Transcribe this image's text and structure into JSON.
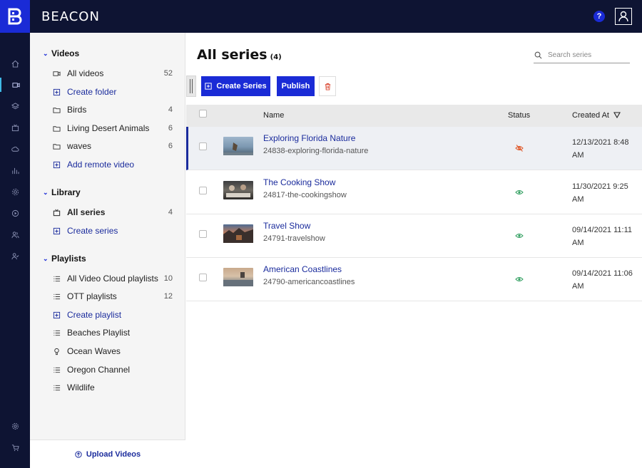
{
  "app": {
    "brand": "BEACON",
    "help_label": "?"
  },
  "sidebar": {
    "videos_heading": "Videos",
    "videos": [
      {
        "label": "All videos",
        "count": "52",
        "icon": "video-icon"
      },
      {
        "label": "Create folder",
        "count": "",
        "icon": "plus-square-icon"
      },
      {
        "label": "Birds",
        "count": "4",
        "icon": "folder-icon"
      },
      {
        "label": "Living Desert Animals",
        "count": "6",
        "icon": "folder-icon"
      },
      {
        "label": "waves",
        "count": "6",
        "icon": "folder-icon"
      },
      {
        "label": "Add remote video",
        "count": "",
        "icon": "plus-square-icon"
      }
    ],
    "library_heading": "Library",
    "library": [
      {
        "label": "All series",
        "count": "4",
        "icon": "tv-icon"
      },
      {
        "label": "Create series",
        "count": "",
        "icon": "plus-square-icon"
      }
    ],
    "playlists_heading": "Playlists",
    "playlists": [
      {
        "label": "All Video Cloud playlists",
        "count": "10",
        "icon": "list-icon"
      },
      {
        "label": "OTT playlists",
        "count": "12",
        "icon": "list-icon"
      },
      {
        "label": "Create playlist",
        "count": "",
        "icon": "plus-square-icon"
      },
      {
        "label": "Beaches Playlist",
        "count": "",
        "icon": "list-icon"
      },
      {
        "label": "Ocean Waves",
        "count": "",
        "icon": "lightbulb-icon"
      },
      {
        "label": "Oregon Channel",
        "count": "",
        "icon": "list-icon"
      },
      {
        "label": "Wildlife",
        "count": "",
        "icon": "list-icon"
      }
    ],
    "upload_label": "Upload Videos"
  },
  "main": {
    "title": "All series",
    "title_count": "(4)",
    "search_placeholder": "Search series",
    "create_label": "Create Series",
    "publish_label": "Publish",
    "columns": {
      "name": "Name",
      "status": "Status",
      "created": "Created At"
    },
    "rows": [
      {
        "name": "Exploring Florida Nature",
        "slug": "24838-exploring-florida-nature",
        "status": "hidden",
        "created_line1": "12/13/2021 8:48",
        "created_line2": "AM"
      },
      {
        "name": "The Cooking Show",
        "slug": "24817-the-cookingshow",
        "status": "visible",
        "created_line1": "11/30/2021 9:25",
        "created_line2": "AM"
      },
      {
        "name": "Travel Show",
        "slug": "24791-travelshow",
        "status": "visible",
        "created_line1": "09/14/2021 11:11",
        "created_line2": "AM"
      },
      {
        "name": "American Coastlines",
        "slug": "24790-americancoastlines",
        "status": "visible",
        "created_line1": "09/14/2021 11:06",
        "created_line2": "AM"
      }
    ]
  },
  "colors": {
    "nav_bg": "#0e1433",
    "accent": "#1a2bd6",
    "link": "#1a2b9c",
    "status_hidden": "#e05a2b",
    "status_visible": "#2f9e5e"
  }
}
